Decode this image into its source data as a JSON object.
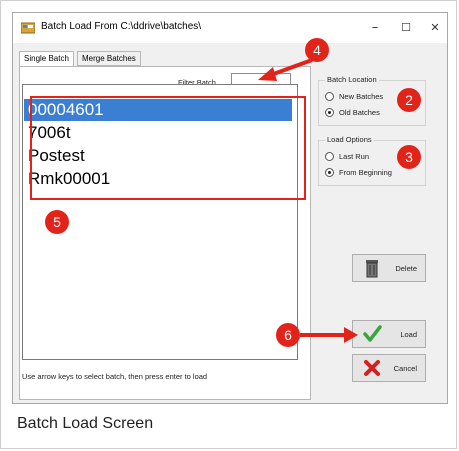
{
  "window": {
    "title": "Batch Load From C:\\ddrive\\batches\\",
    "minimize": "–",
    "maximize": "☐",
    "close": "✕"
  },
  "tabs": [
    {
      "label": "Single Batch",
      "active": true
    },
    {
      "label": "Merge Batches",
      "active": false
    }
  ],
  "filter": {
    "label": "Filter Batch",
    "value": ""
  },
  "batches": [
    {
      "label": "00004601",
      "selected": true
    },
    {
      "label": "7006t",
      "selected": false
    },
    {
      "label": "Postest",
      "selected": false
    },
    {
      "label": "Rmk00001",
      "selected": false
    }
  ],
  "hint": "Use arrow keys to select batch, then press enter to load",
  "batch_location": {
    "title": "Batch Location",
    "options": [
      {
        "label": "New Batches",
        "checked": false
      },
      {
        "label": "Old Batches",
        "checked": true
      }
    ]
  },
  "load_options": {
    "title": "Load Options",
    "options": [
      {
        "label": "Last Run",
        "checked": false
      },
      {
        "label": "From Beginning",
        "checked": true
      }
    ]
  },
  "buttons": {
    "delete": "Delete",
    "load": "Load",
    "cancel": "Cancel"
  },
  "callouts": [
    "2",
    "3",
    "4",
    "5",
    "6"
  ],
  "caption": "Batch Load Screen",
  "colors": {
    "callout": "#e2231a",
    "selection": "#3a7fd4"
  }
}
